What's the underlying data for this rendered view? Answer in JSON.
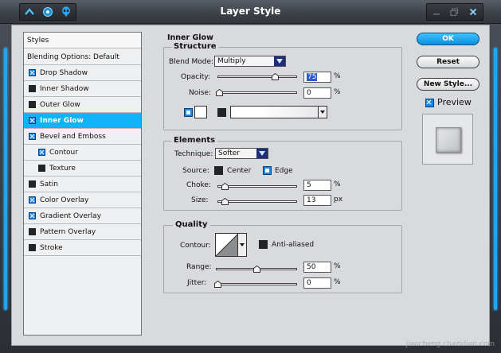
{
  "window": {
    "title": "Layer Style"
  },
  "styles_list": {
    "header": "Styles",
    "items": [
      {
        "label": "Blending Options: Default",
        "checkbox": null,
        "indent": false,
        "selected": false
      },
      {
        "label": "Drop Shadow",
        "checkbox": true,
        "indent": false,
        "selected": false
      },
      {
        "label": "Inner Shadow",
        "checkbox": false,
        "indent": false,
        "selected": false
      },
      {
        "label": "Outer Glow",
        "checkbox": false,
        "indent": false,
        "selected": false
      },
      {
        "label": "Inner Glow",
        "checkbox": true,
        "indent": false,
        "selected": true
      },
      {
        "label": "Bevel and Emboss",
        "checkbox": true,
        "indent": false,
        "selected": false
      },
      {
        "label": "Contour",
        "checkbox": true,
        "indent": true,
        "selected": false
      },
      {
        "label": "Texture",
        "checkbox": false,
        "indent": true,
        "selected": false
      },
      {
        "label": "Satin",
        "checkbox": false,
        "indent": false,
        "selected": false
      },
      {
        "label": "Color Overlay",
        "checkbox": true,
        "indent": false,
        "selected": false
      },
      {
        "label": "Gradient Overlay",
        "checkbox": true,
        "indent": false,
        "selected": false
      },
      {
        "label": "Pattern Overlay",
        "checkbox": false,
        "indent": false,
        "selected": false
      },
      {
        "label": "Stroke",
        "checkbox": false,
        "indent": false,
        "selected": false
      }
    ]
  },
  "panel": {
    "title": "Inner Glow",
    "structure": {
      "title": "Structure",
      "blend_mode_label": "Blend Mode:",
      "blend_mode_value": "Multiply",
      "opacity_label": "Opacity:",
      "opacity_value": "75",
      "opacity_unit": "%",
      "opacity_fraction": 0.75,
      "noise_label": "Noise:",
      "noise_value": "0",
      "noise_unit": "%",
      "noise_fraction": 0.0
    },
    "elements": {
      "title": "Elements",
      "technique_label": "Technique:",
      "technique_value": "Softer",
      "source_label": "Source:",
      "source_center_label": "Center",
      "source_edge_label": "Edge",
      "source_selected": "Edge",
      "choke_label": "Choke:",
      "choke_value": "5",
      "choke_unit": "%",
      "choke_fraction": 0.05,
      "size_label": "Size:",
      "size_value": "13",
      "size_unit": "px",
      "size_fraction": 0.05
    },
    "quality": {
      "title": "Quality",
      "contour_label": "Contour:",
      "anti_aliased_label": "Anti-aliased",
      "anti_aliased_checked": false,
      "range_label": "Range:",
      "range_value": "50",
      "range_unit": "%",
      "range_fraction": 0.5,
      "jitter_label": "Jitter:",
      "jitter_value": "0",
      "jitter_unit": "%",
      "jitter_fraction": 0.0
    }
  },
  "buttons": {
    "ok": "OK",
    "reset": "Reset",
    "new_style": "New Style...",
    "preview_label": "Preview",
    "preview_checked": true
  },
  "watermark": "jiaocheng.chazidian.com",
  "colors": {
    "accent": "#10b4f6",
    "selected_row": "#10b4f6",
    "client_bg": "#d9dadd"
  }
}
